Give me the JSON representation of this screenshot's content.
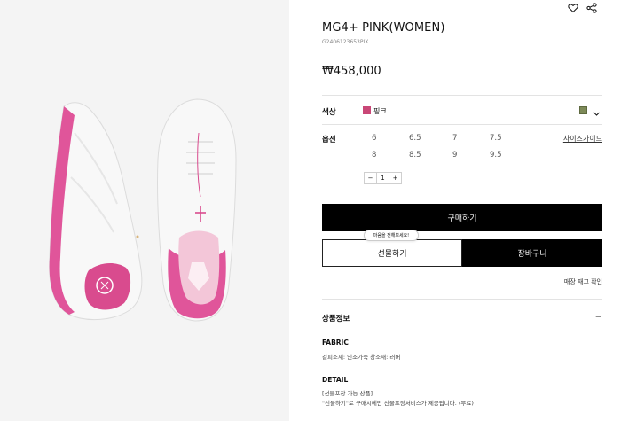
{
  "product": {
    "title": "MG4+ PINK(WOMEN)",
    "code": "G2406123653PIX",
    "price": "₩458,000"
  },
  "color": {
    "label": "색상",
    "selected": "핑크",
    "selected_hex": "#c94777",
    "alt_hex": "#7d8a58"
  },
  "option": {
    "label": "옵션",
    "sizes": [
      "6",
      "6.5",
      "7",
      "7.5",
      "8",
      "8.5",
      "9",
      "9.5"
    ],
    "size_guide": "사이즈가이드"
  },
  "quantity": {
    "minus": "−",
    "value": "1",
    "plus": "+"
  },
  "actions": {
    "buy": "구매하기",
    "gift_tooltip": "마음을 전해보세요!",
    "gift": "선물하기",
    "cart": "장바구니",
    "store_stock": "매장 재고 확인"
  },
  "info": {
    "title": "상품정보",
    "collapse": "−",
    "fabric_title": "FABRIC",
    "fabric_text": "겉피소재: 인조가죽 창소재: 러버",
    "detail_title": "DETAIL",
    "detail_line1": "[선물포장 가능 상품]",
    "detail_line2": "\"선물하기\"로 구매시에만 선물포장서비스가 제공됩니다. (무료)"
  },
  "icons": {
    "wishlist": "heart-icon",
    "share": "share-icon",
    "dropdown": "chevron-down-icon"
  }
}
